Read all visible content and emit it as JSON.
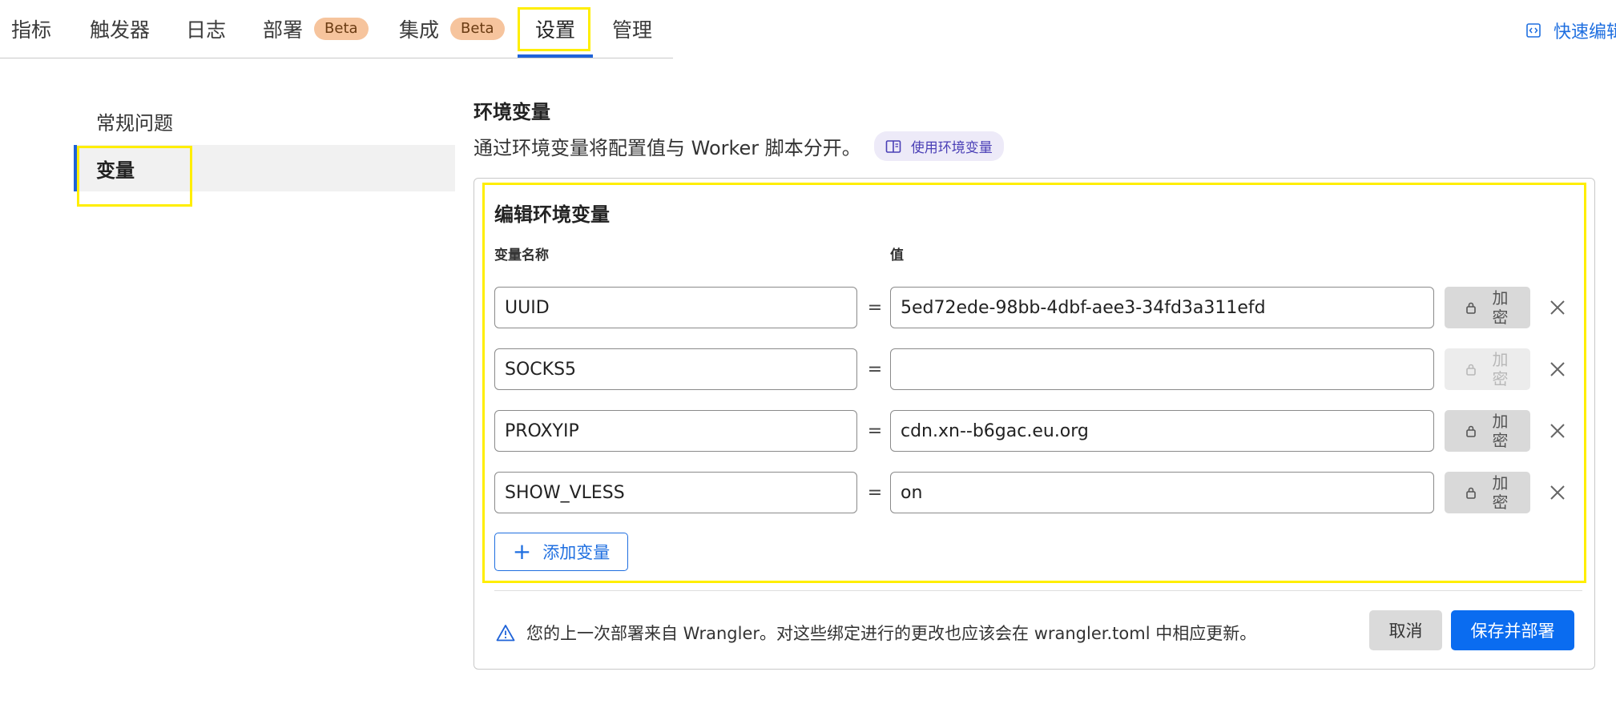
{
  "tabs": [
    {
      "label": "指标"
    },
    {
      "label": "触发器"
    },
    {
      "label": "日志"
    },
    {
      "label": "部署",
      "badge": "Beta"
    },
    {
      "label": "集成",
      "badge": "Beta"
    },
    {
      "label": "设置"
    },
    {
      "label": "管理"
    }
  ],
  "active_tab": "设置",
  "quick_edit": {
    "label": "快速编辑",
    "icon": "code-icon"
  },
  "sidebar": {
    "items": [
      {
        "label": "常规问题"
      },
      {
        "label": "变量"
      }
    ],
    "active": "变量"
  },
  "section": {
    "title": "环境变量",
    "description": "通过环境变量将配置值与 Worker 脚本分开。",
    "doc_link": {
      "label": "使用环境变量",
      "icon": "book-icon"
    }
  },
  "editor": {
    "title": "编辑环境变量",
    "col_name_label": "变量名称",
    "col_value_label": "值",
    "equals": "=",
    "encrypt_label": "加密",
    "variables": [
      {
        "name": "UUID",
        "value": "5ed72ede-98bb-4dbf-aee3-34fd3a311efd",
        "encrypt_enabled": true
      },
      {
        "name": "SOCKS5",
        "value": "",
        "encrypt_enabled": false
      },
      {
        "name": "PROXYIP",
        "value": "cdn.xn--b6gac.eu.org",
        "encrypt_enabled": true
      },
      {
        "name": "SHOW_VLESS",
        "value": "on",
        "encrypt_enabled": true
      }
    ],
    "add_label": "添加变量"
  },
  "footer": {
    "warning": "您的上一次部署来自 Wrangler。对这些绑定进行的更改也应该会在 wrangler.toml 中相应更新。",
    "cancel_label": "取消",
    "save_label": "保存并部署"
  },
  "colors": {
    "accent": "#1f63d8",
    "primary_button": "#0a6cf0",
    "highlight": "#ffee00",
    "badge_bg": "#f6c49d"
  }
}
